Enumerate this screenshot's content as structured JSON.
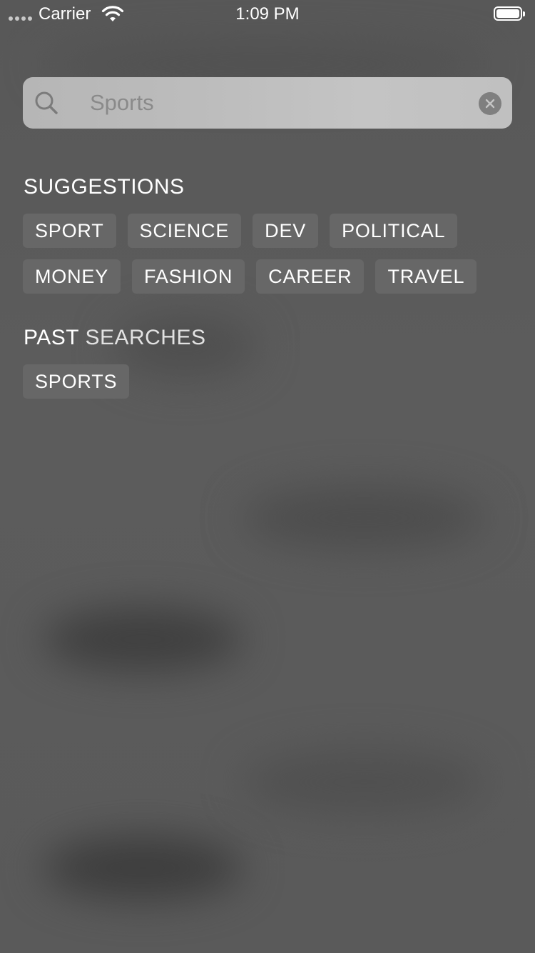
{
  "status_bar": {
    "carrier": "Carrier",
    "time": "1:09 PM"
  },
  "search": {
    "value": "",
    "placeholder": "Sports",
    "icon": "search-icon",
    "clear_icon": "clear-icon"
  },
  "suggestions": {
    "heading": "SUGGESTIONS",
    "items": [
      {
        "label": "SPORT"
      },
      {
        "label": "SCIENCE"
      },
      {
        "label": "DEV"
      },
      {
        "label": "POLITICAL"
      },
      {
        "label": "MONEY"
      },
      {
        "label": "FASHION"
      },
      {
        "label": "CAREER"
      },
      {
        "label": "TRAVEL"
      }
    ]
  },
  "past_searches": {
    "heading_part1": "PAST",
    "heading_part2": "SEARCHES",
    "items": [
      {
        "label": "SPORTS"
      }
    ]
  },
  "colors": {
    "background": "#5a5a5a",
    "search_field": "#bcbcbc",
    "chip": "#676767",
    "text": "#ffffff"
  }
}
